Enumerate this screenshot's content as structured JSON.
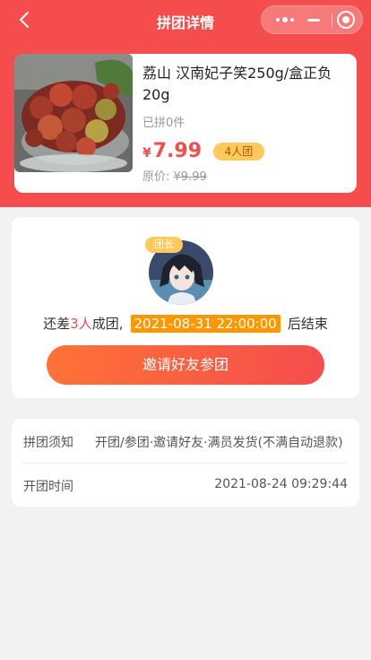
{
  "nav": {
    "title": "拼团详情"
  },
  "product": {
    "name": "荔山 汉南妃子笑250g/盒正负20g",
    "sold": "已拼0件",
    "currency": "¥",
    "price": "7.99",
    "group_badge": "4人团",
    "original_label": "原价:",
    "original_price": "¥9.99"
  },
  "group": {
    "leader_badge": "团长",
    "prefix": "还差",
    "need_count": "3人",
    "middle": "成团,",
    "deadline": "2021-08-31 22:00:00",
    "suffix": "后结束",
    "invite_button": "邀请好友参团"
  },
  "info": {
    "rows": [
      {
        "label": "拼团须知",
        "value": "开团/参团·邀请好友·满员发货(不满自动退款)"
      },
      {
        "label": "开团时间",
        "value": "2021-08-24 09:29:44"
      }
    ]
  },
  "colors": {
    "primary": "#f54d4d",
    "accent": "#ff9800",
    "badge": "#ffc95c"
  }
}
